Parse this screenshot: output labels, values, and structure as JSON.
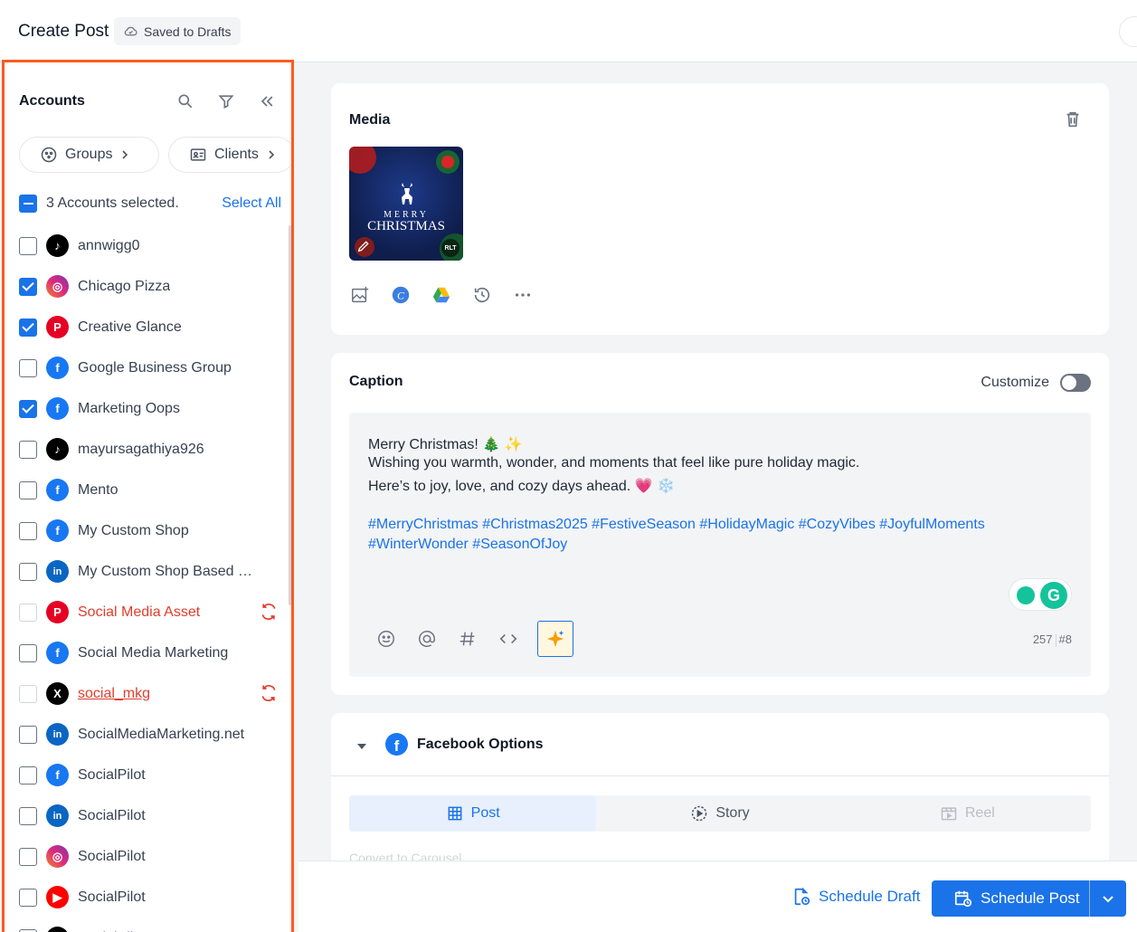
{
  "header": {
    "title": "Create Post",
    "saved_label": "Saved to Drafts"
  },
  "sidebar": {
    "heading": "Accounts",
    "chips": {
      "groups": "Groups",
      "clients": "Clients"
    },
    "selected_text": "3 Accounts selected.",
    "select_all": "Select All",
    "accounts": [
      {
        "name": "annwigg0",
        "platform": "tiktok",
        "checked": false,
        "error": false
      },
      {
        "name": "Chicago Pizza",
        "platform": "instagram",
        "checked": true,
        "error": false
      },
      {
        "name": "Creative Glance",
        "platform": "pinterest",
        "checked": true,
        "error": false
      },
      {
        "name": "Google Business Group",
        "platform": "facebook",
        "checked": false,
        "error": false
      },
      {
        "name": "Marketing Oops",
        "platform": "facebook",
        "checked": true,
        "error": false
      },
      {
        "name": "mayursagathiya926",
        "platform": "tiktok",
        "checked": false,
        "error": false
      },
      {
        "name": "Mento",
        "platform": "facebook",
        "checked": false,
        "error": false
      },
      {
        "name": "My Custom Shop",
        "platform": "facebook",
        "checked": false,
        "error": false
      },
      {
        "name": "My Custom Shop Based o…",
        "platform": "linkedin",
        "checked": false,
        "error": false
      },
      {
        "name": "Social Media Asset",
        "platform": "pinterest",
        "checked": false,
        "error": true
      },
      {
        "name": "Social Media Marketing",
        "platform": "facebook",
        "checked": false,
        "error": false
      },
      {
        "name": "social_mkg",
        "platform": "x",
        "checked": false,
        "error": true
      },
      {
        "name": "SocialMediaMarketing.net",
        "platform": "linkedin",
        "checked": false,
        "error": false
      },
      {
        "name": "SocialPilot",
        "platform": "facebook",
        "checked": false,
        "error": false
      },
      {
        "name": "SocialPilot",
        "platform": "linkedin",
        "checked": false,
        "error": false
      },
      {
        "name": "SocialPilot",
        "platform": "instagram",
        "checked": false,
        "error": false
      },
      {
        "name": "SocialPilot",
        "platform": "youtube",
        "checked": false,
        "error": false
      },
      {
        "name": "SocialPilot",
        "platform": "tiktok",
        "checked": false,
        "error": false
      }
    ]
  },
  "media": {
    "title": "Media",
    "thumb_line1": "MERRY",
    "thumb_line2": "CHRISTMAS",
    "thumb_badge": "RLT"
  },
  "caption": {
    "title": "Caption",
    "customize_label": "Customize",
    "line1": "Merry Christmas! 🎄 ✨",
    "line2": "Wishing you warmth, wonder, and moments that feel like pure holiday magic.",
    "line3": "Here’s to joy, love, and cozy days ahead. 💗 ❄️",
    "hashtags_line1": "#MerryChristmas #Christmas2025 #FestiveSeason #HolidayMagic #CozyVibes #JoyfulMoments",
    "hashtags_line2": "#WinterWonder #SeasonOfJoy",
    "char_count": "257",
    "hash_count": "#8"
  },
  "facebook": {
    "title": "Facebook Options",
    "tabs": [
      "Post",
      "Story",
      "Reel"
    ],
    "hidden_text": "Convert to Carousel"
  },
  "footer": {
    "draft_label": "Schedule Draft",
    "primary_label": "Schedule Post"
  },
  "colors": {
    "accent": "#1a73e8",
    "highlight": "#ff5a1f",
    "error": "#e03d2c"
  }
}
